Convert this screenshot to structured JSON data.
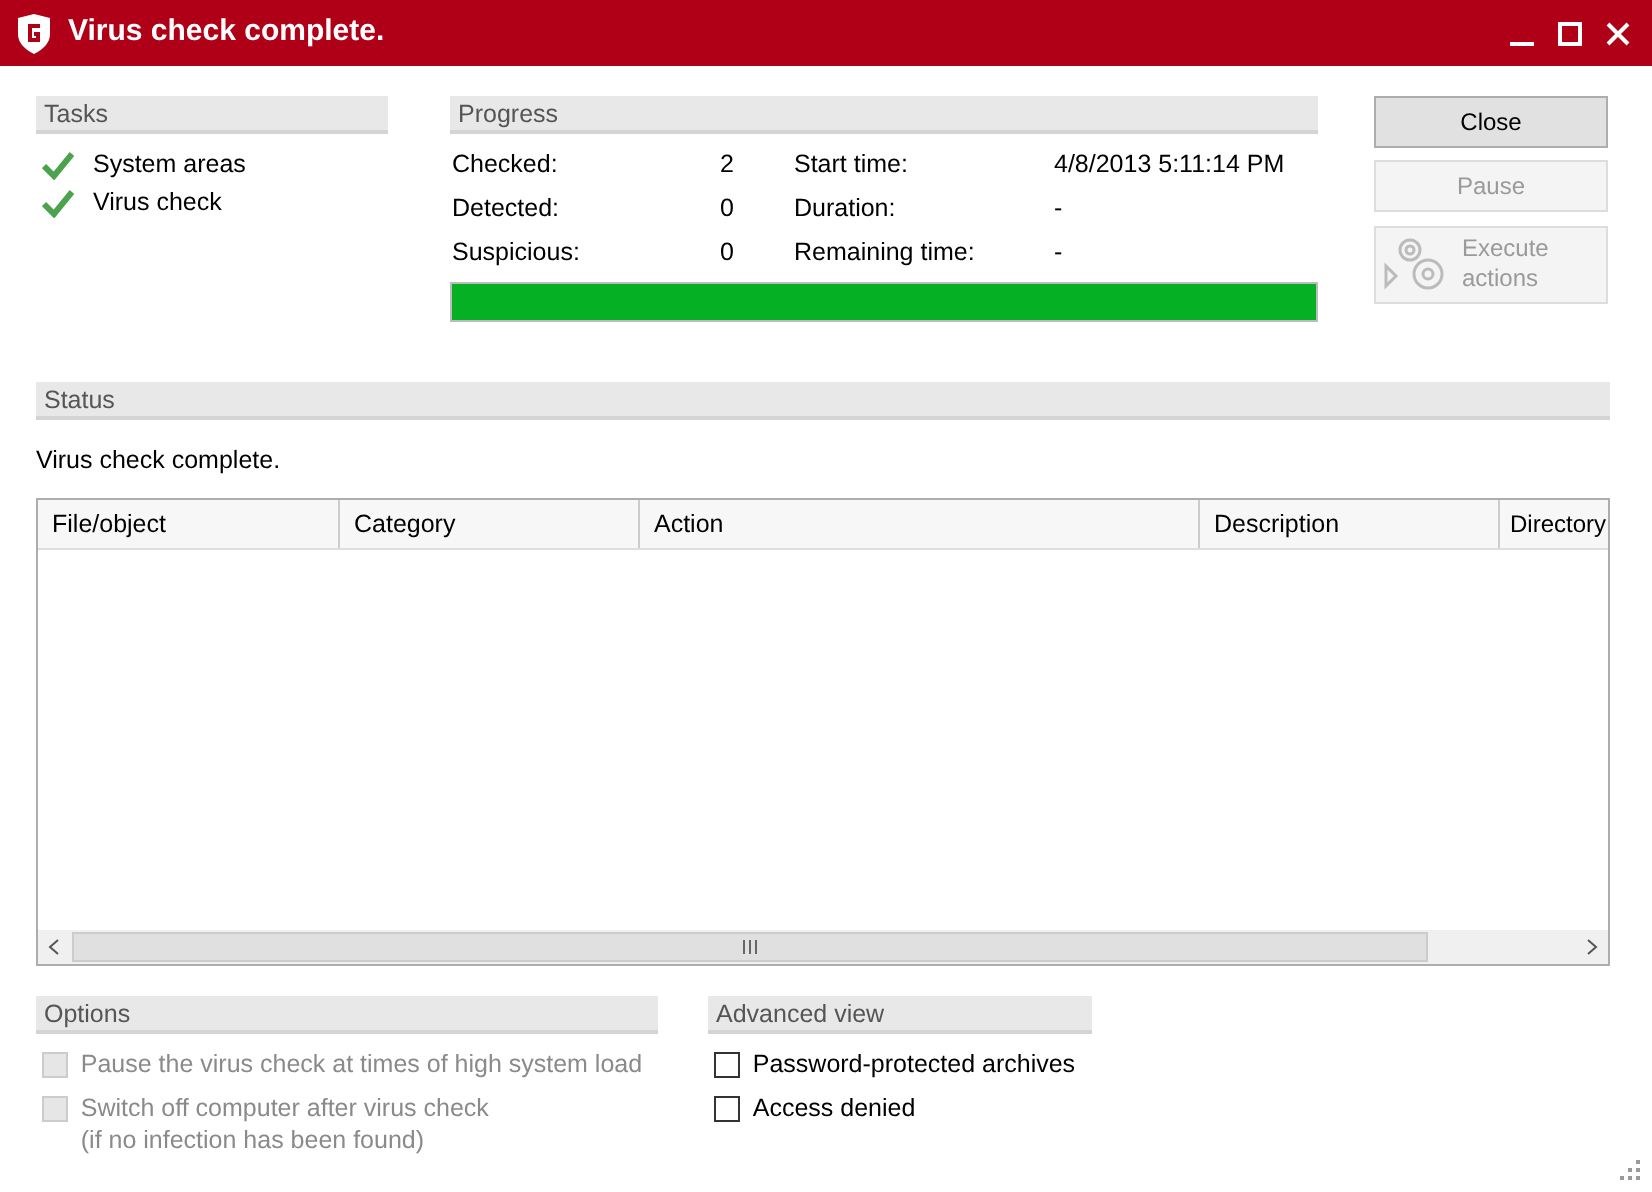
{
  "window": {
    "title": "Virus check complete."
  },
  "tasks": {
    "heading": "Tasks",
    "items": [
      {
        "label": "System areas",
        "done": true
      },
      {
        "label": "Virus check",
        "done": true
      }
    ]
  },
  "progress": {
    "heading": "Progress",
    "level": 1,
    "stats": [
      {
        "label": "Checked:",
        "value": "2",
        "label2": "Start time:",
        "value2": "4/8/2013 5:11:14 PM"
      },
      {
        "label": "Detected:",
        "value": "0",
        "label2": "Duration:",
        "value2": "-"
      },
      {
        "label": "Suspicious:",
        "value": "0",
        "label2": "Remaining time:",
        "value2": "-"
      }
    ]
  },
  "buttons": [
    {
      "label": "Close",
      "disabled": false,
      "kind": "text"
    },
    {
      "label": "Pause",
      "disabled": true,
      "kind": "text"
    },
    {
      "label": "Execute actions",
      "disabled": true,
      "kind": "gears"
    }
  ],
  "status": {
    "heading": "Status",
    "message": "Virus check complete."
  },
  "table": {
    "columns": [
      "File/object",
      "Category",
      "Action",
      "Description",
      "Directory"
    ]
  },
  "options": {
    "heading": "Options",
    "items": [
      {
        "label": "Pause the virus check at times of high system load",
        "checked": false,
        "disabled": true
      },
      {
        "label": "Switch off computer after virus check\n(if no infection has been found)",
        "checked": false,
        "disabled": true
      }
    ]
  },
  "advanced_view": {
    "heading": "Advanced view",
    "items": [
      {
        "label": "Password-protected archives",
        "checked": false,
        "disabled": false
      },
      {
        "label": "Access denied",
        "checked": false,
        "disabled": false
      }
    ]
  }
}
